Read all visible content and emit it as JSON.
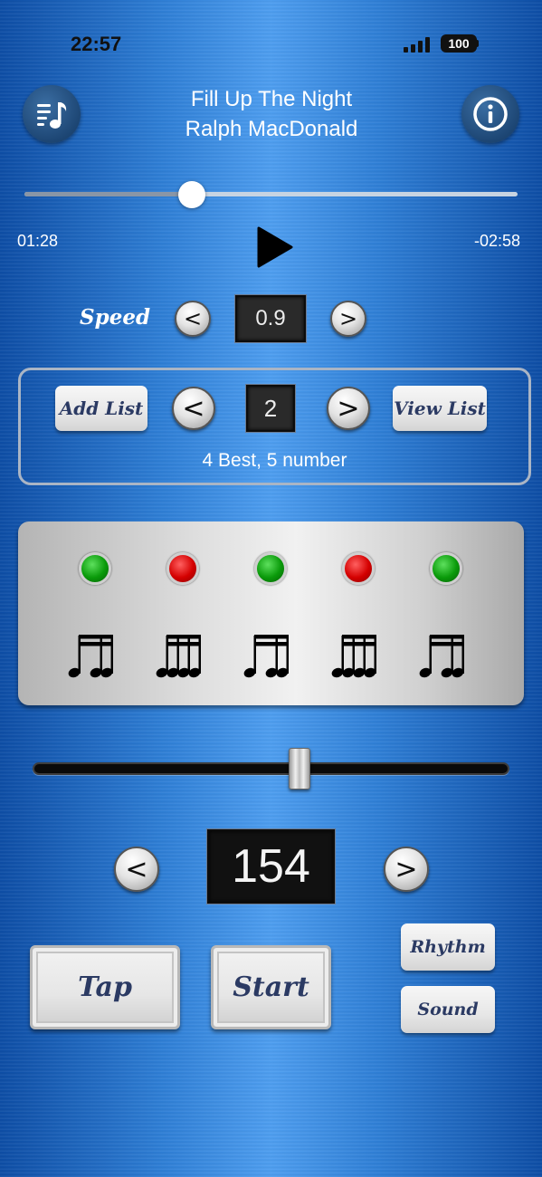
{
  "status_bar": {
    "time": "22:57",
    "battery": "100"
  },
  "header": {
    "library_icon": "music-list-icon",
    "info_icon": "info-icon",
    "song_title": "Fill Up The Night",
    "artist": "Ralph MacDonald"
  },
  "player": {
    "elapsed": "01:28",
    "remaining": "-02:58",
    "progress": 0.34,
    "play_icon": "play-icon"
  },
  "speed": {
    "label": "Speed",
    "value": "0.9",
    "decrease": "<",
    "increase": ">"
  },
  "list": {
    "add_label": "Add List",
    "view_label": "View List",
    "index": "2",
    "decrease": "<",
    "increase": ">",
    "summary": "4 Best, 5 number"
  },
  "rhythm_panel": {
    "beats": [
      {
        "led": "green",
        "note": "sixteenth-note-group-icon"
      },
      {
        "led": "red",
        "note": "sixteenth-note-quad-icon"
      },
      {
        "led": "green",
        "note": "sixteenth-note-group-icon"
      },
      {
        "led": "red",
        "note": "sixteenth-note-quad-icon"
      },
      {
        "led": "green",
        "note": "sixteenth-note-group-icon"
      }
    ],
    "colors": {
      "green": "#0a9a0a",
      "red": "#d40000"
    }
  },
  "tempo": {
    "bpm": "154",
    "slider_level": 0.56,
    "decrease": "<",
    "increase": ">"
  },
  "buttons": {
    "tap": "Tap",
    "start": "Start",
    "rhythm": "Rhythm",
    "sound": "Sound"
  }
}
